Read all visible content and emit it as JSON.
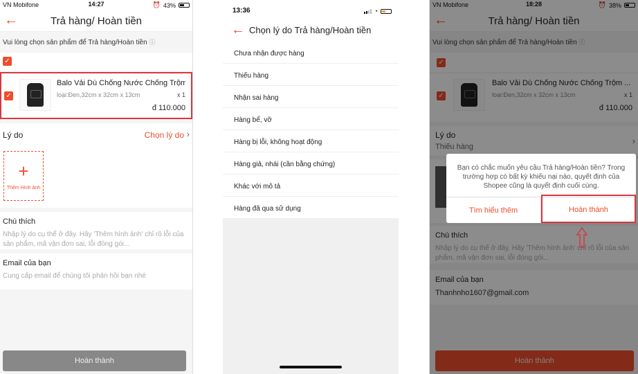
{
  "panel1": {
    "status": {
      "carrier": "VN Mobifone",
      "time": "14:27",
      "battery": "43%"
    },
    "header": {
      "title": "Trả hàng/ Hoàn tiền"
    },
    "hint": "Vui lòng chọn sản phẩm để Trả hàng/Hoàn tiền",
    "product": {
      "name": "Balo Vải Dù Chống Nước Chống Trộm ...",
      "variant": "loại:Đen,32cm x 32cm x 13cm",
      "qty": "x 1",
      "price": "đ 110.000"
    },
    "reason": {
      "label": "Lý do",
      "value": "Chọn lý do"
    },
    "add_image": "Thêm Hình ảnh",
    "note": {
      "label": "Chú thích",
      "placeholder": "Nhập lý do cụ thể ở đây. Hãy 'Thêm hình ảnh' chỉ rõ lỗi của sản phẩm, mã vận đơn sai, lỗi đóng gói..."
    },
    "email": {
      "label": "Email của bạn",
      "placeholder": "Cung cấp email để chúng tôi phản hồi bạn nhé"
    },
    "submit": "Hoàn thành"
  },
  "panel2": {
    "status": {
      "time": "13:36"
    },
    "header": {
      "title": "Chọn lý do Trả hàng/Hoàn tiền"
    },
    "reasons": [
      "Chưa nhận được hàng",
      "Thiếu hàng",
      "Nhận sai hàng",
      "Hàng bể, vỡ",
      "Hàng bị lỗi, không hoạt động",
      "Hàng giả, nhái (cần bằng chứng)",
      "Khác với mô tả",
      "Hàng đã qua sử dụng"
    ]
  },
  "panel3": {
    "status": {
      "carrier": "VN Mobifone",
      "time": "18:28",
      "battery": "38%"
    },
    "header": {
      "title": "Trả hàng/ Hoàn tiền"
    },
    "hint": "Vui lòng chọn sản phẩm để Trả hàng/Hoàn tiền",
    "product": {
      "name": "Balo Vải Dù Chống Nước Chống Trộm ...",
      "variant": "loại:Đen,32cm x 32cm x 13cm",
      "qty": "x 1",
      "price": "đ 110.000"
    },
    "reason": {
      "label": "Lý do",
      "value": "Thiếu hàng"
    },
    "note": {
      "label": "Chú thích",
      "placeholder": "Nhập lý do cụ thể ở đây. Hãy 'Thêm hình ảnh' chỉ rõ lỗi của sản phẩm, mã vận đơn sai, lỗi đóng gói..."
    },
    "email": {
      "label": "Email của bạn",
      "value": "Thanhnho1607@gmail.com"
    },
    "dialog": {
      "message": "Bạn có chắc muốn yêu cầu Trả hàng/Hoàn tiền? Trong trường hợp có bất kỳ khiếu nại nào, quyết định của Shopee cũng là quyết định cuối cùng.",
      "learn_more": "Tìm hiểu thêm",
      "confirm": "Hoàn thành"
    },
    "submit": "Hoàn thành"
  },
  "colors": {
    "accent": "#ee4d2d",
    "highlight": "#d9363e"
  }
}
